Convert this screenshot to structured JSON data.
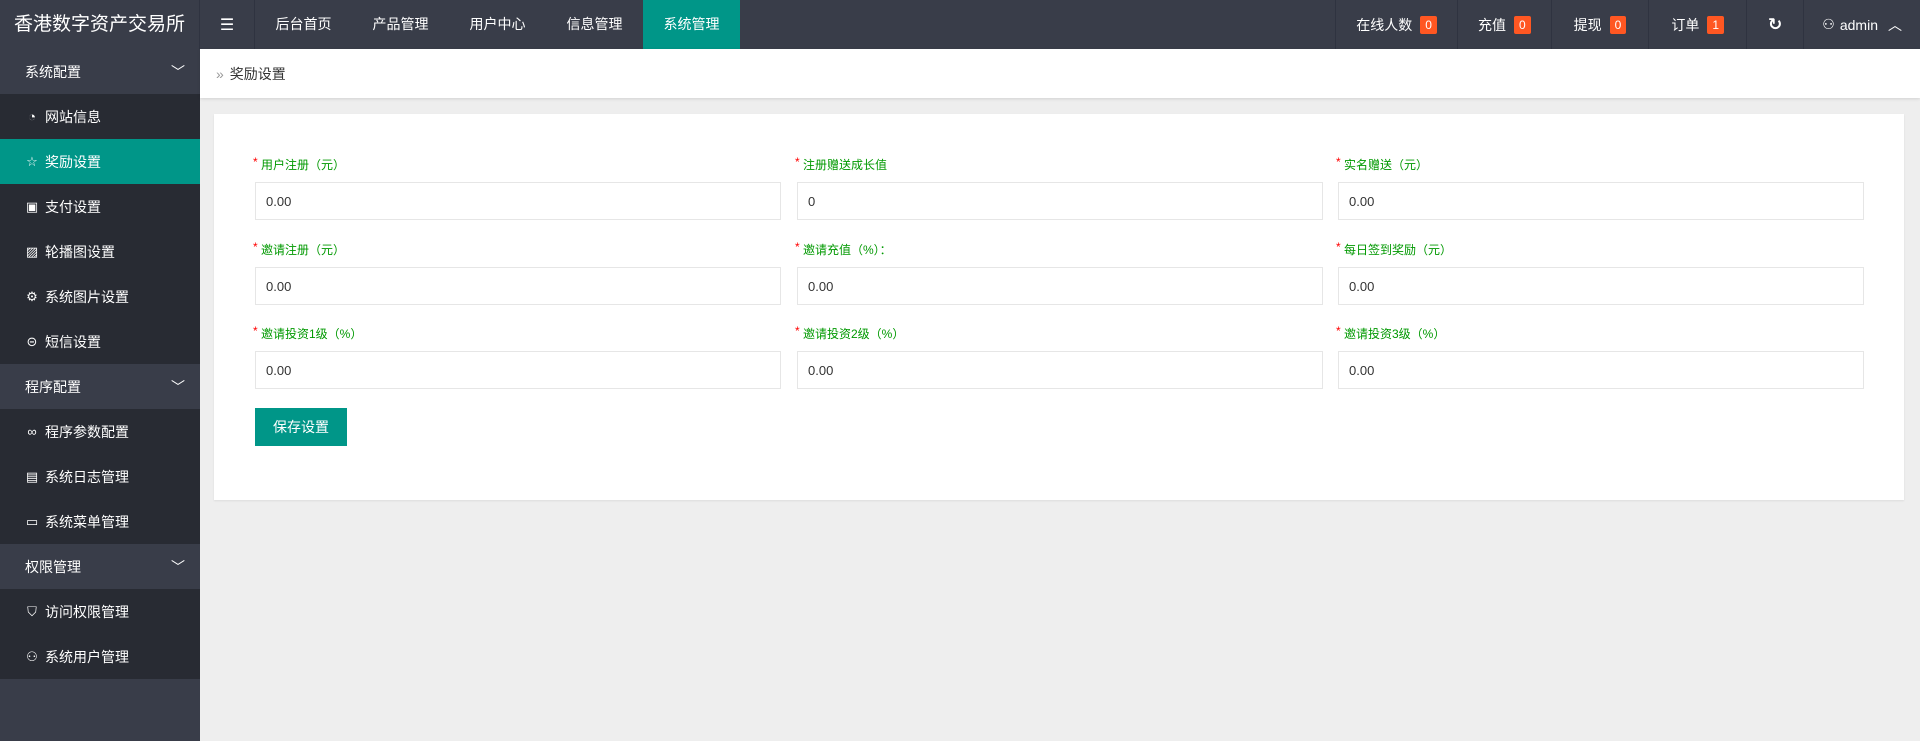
{
  "app_title": "香港数字资产交易所",
  "nav_tabs": [
    {
      "label": "后台首页"
    },
    {
      "label": "产品管理"
    },
    {
      "label": "用户中心"
    },
    {
      "label": "信息管理"
    },
    {
      "label": "系统管理",
      "active": true
    }
  ],
  "header_right": {
    "online_label": "在线人数",
    "online_count": "0",
    "recharge_label": "充值",
    "recharge_count": "0",
    "withdraw_label": "提现",
    "withdraw_count": "0",
    "order_label": "订单",
    "order_count": "1",
    "user": "admin"
  },
  "sidebar": {
    "groups": [
      {
        "label": "系统配置",
        "items": [
          {
            "label": "网站信息",
            "icon": "dashboard-icon"
          },
          {
            "label": "奖励设置",
            "icon": "star-icon",
            "active": true
          },
          {
            "label": "支付设置",
            "icon": "money-icon"
          },
          {
            "label": "轮播图设置",
            "icon": "image-icon"
          },
          {
            "label": "系统图片设置",
            "icon": "gear-icon"
          },
          {
            "label": "短信设置",
            "icon": "chat-icon"
          }
        ]
      },
      {
        "label": "程序配置",
        "items": [
          {
            "label": "程序参数配置",
            "icon": "link-icon"
          },
          {
            "label": "系统日志管理",
            "icon": "clipboard-icon"
          },
          {
            "label": "系统菜单管理",
            "icon": "window-icon"
          }
        ]
      },
      {
        "label": "权限管理",
        "items": [
          {
            "label": "访问权限管理",
            "icon": "shield-icon"
          },
          {
            "label": "系统用户管理",
            "icon": "user-icon"
          }
        ]
      }
    ]
  },
  "breadcrumb": "奖励设置",
  "form": {
    "fields": [
      {
        "label": "用户注册（元）",
        "value": "0.00"
      },
      {
        "label": "注册赠送成长值",
        "value": "0"
      },
      {
        "label": "实名赠送（元）",
        "value": "0.00"
      },
      {
        "label": "邀请注册（元）",
        "value": "0.00"
      },
      {
        "label": "邀请充值（%）：",
        "value": "0.00"
      },
      {
        "label": "每日签到奖励（元）",
        "value": "0.00"
      },
      {
        "label": "邀请投资1级（%）",
        "value": "0.00"
      },
      {
        "label": "邀请投资2级（%）",
        "value": "0.00"
      },
      {
        "label": "邀请投资3级（%）",
        "value": "0.00"
      }
    ],
    "required_mark": "*",
    "save_label": "保存设置"
  },
  "colors": {
    "accent": "#009688",
    "topbar": "#393D49",
    "sidebar": "#282B33",
    "badge": "#FF5722",
    "label": "#009900"
  }
}
